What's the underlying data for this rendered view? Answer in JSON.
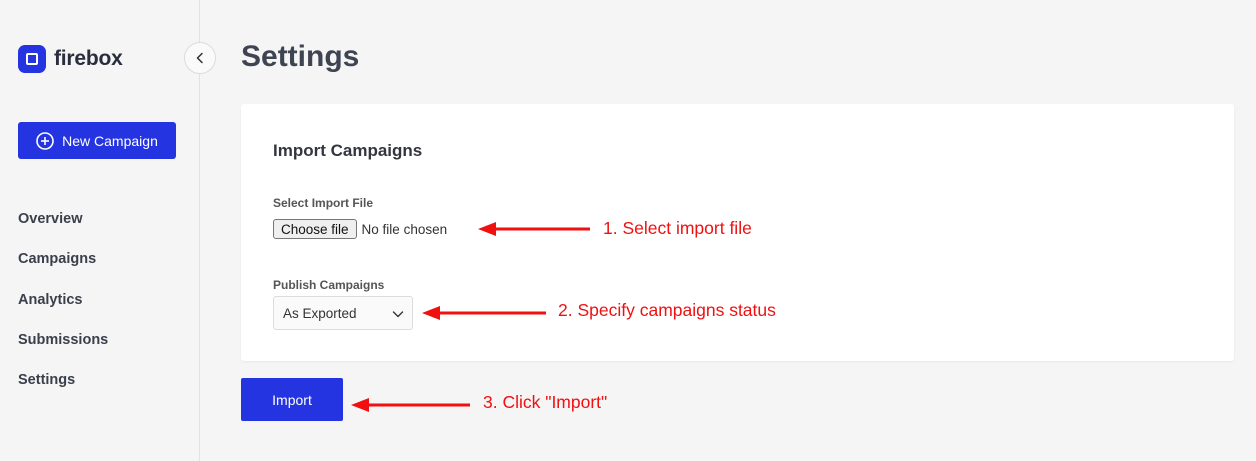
{
  "sidebar": {
    "logo_text": "firebox",
    "new_campaign_label": "New Campaign",
    "items": [
      {
        "label": "Overview"
      },
      {
        "label": "Campaigns"
      },
      {
        "label": "Analytics"
      },
      {
        "label": "Submissions"
      },
      {
        "label": "Settings"
      }
    ]
  },
  "main": {
    "title": "Settings",
    "card": {
      "title": "Import Campaigns",
      "file_label": "Select Import File",
      "choose_file_label": "Choose file",
      "file_status": "No file chosen",
      "publish_label": "Publish Campaigns",
      "publish_selected": "As Exported"
    },
    "import_label": "Import"
  },
  "annotations": [
    {
      "text": "1. Select import file"
    },
    {
      "text": "2. Specify campaigns status"
    },
    {
      "text": "3. Click \"Import\""
    }
  ],
  "colors": {
    "accent": "#2434e0",
    "annotation": "#f01010",
    "background": "#f5f5f5"
  },
  "icons": [
    "logo-icon",
    "chevron-left-icon",
    "plus-circle-icon",
    "chevron-down-icon",
    "arrow-left-icon"
  ]
}
